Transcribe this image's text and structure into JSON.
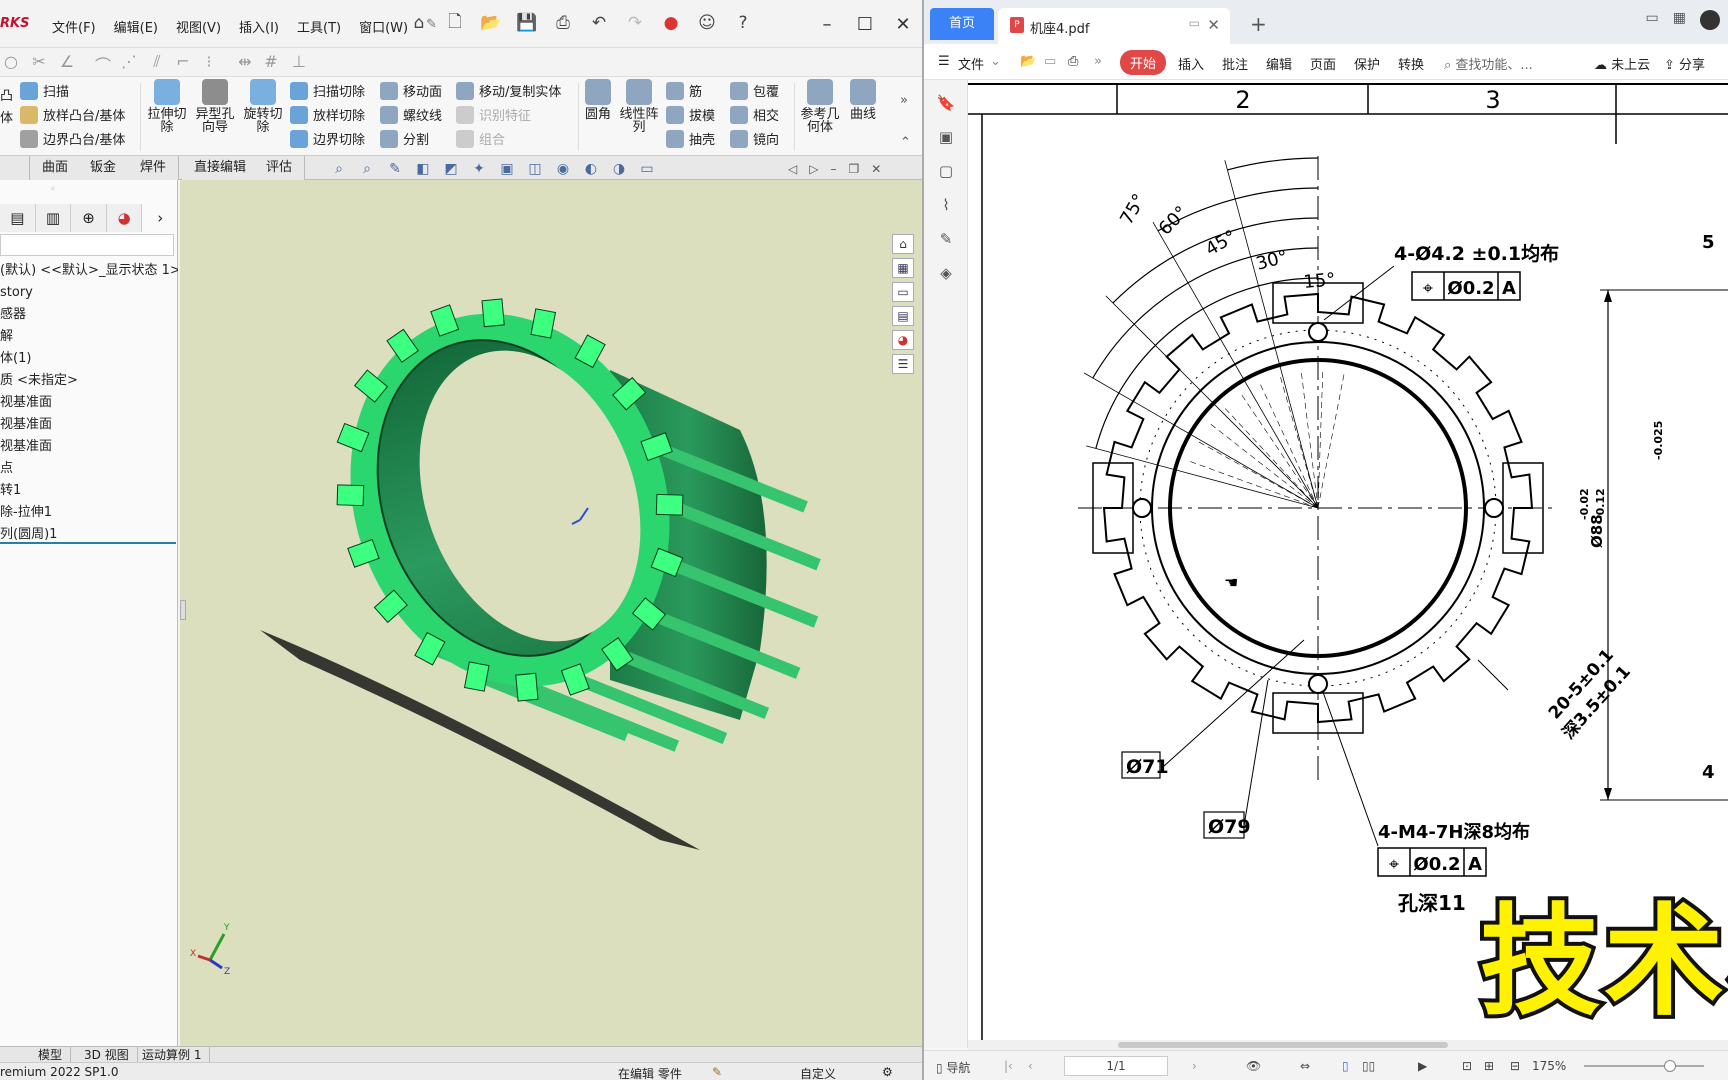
{
  "cad": {
    "brand": "RKS",
    "menu": [
      "文件(F)",
      "编辑(E)",
      "视图(V)",
      "插入(I)",
      "工具(T)",
      "窗口(W)"
    ],
    "ribbon": {
      "col1": [
        "扫描",
        "放样凸台/基体",
        "边界凸台/基体"
      ],
      "col1_partial": [
        "凸",
        "体"
      ],
      "big": [
        "拉伸切除",
        "异型孔向导",
        "旋转切除"
      ],
      "col2": [
        "扫描切除",
        "放样切除",
        "边界切除"
      ],
      "col3": [
        "移动面",
        "螺纹线",
        "分割"
      ],
      "col4": [
        "移动/复制实体",
        "识别特征",
        "组合"
      ],
      "big2": [
        "圆角",
        "线性阵列"
      ],
      "col5": [
        "筋",
        "拔模",
        "抽壳"
      ],
      "col6": [
        "包覆",
        "相交",
        "镜向"
      ],
      "big3": [
        "参考几何体",
        "曲线"
      ]
    },
    "tabs": [
      "曲面",
      "钣金",
      "焊件",
      "直接编辑",
      "评估"
    ],
    "tree": [
      "(默认) <<默认>_显示状态 1>",
      "story",
      "感器",
      "解",
      "体(1)",
      "质 <未指定>",
      "视基准面",
      "视基准面",
      "视基准面",
      "点",
      "转1",
      "除-拉伸1",
      "列(圆周)1"
    ],
    "bottom_tabs": [
      "模型",
      "3D 视图",
      "运动算例 1"
    ],
    "status": {
      "product": "remium 2022 SP1.0",
      "editing": "在编辑 零件",
      "custom": "自定义"
    },
    "part_color": "#1e8c4e",
    "tooth_color": "#3dff80",
    "viewport_bg": "#dcdfbe"
  },
  "pdf": {
    "home_tab": "首页",
    "doc_tab": "机座4.pdf",
    "menu": [
      "文件",
      "开始",
      "插入",
      "批注",
      "编辑",
      "页面",
      "保护",
      "转换"
    ],
    "search": "查找功能、...",
    "right_menu": [
      "未上云",
      "分享"
    ],
    "accent": "#e04848",
    "drawing": {
      "columns": [
        "2",
        "3"
      ],
      "angles": [
        "75°",
        "60°",
        "45°",
        "30°",
        "15°"
      ],
      "hole_callout_top": "4-Ø4.2 ±0.1均布",
      "fcf_top": [
        "⌖",
        "Ø0.2",
        "A"
      ],
      "d71": "Ø71",
      "d79": "Ø79",
      "slot": "20-5±0.1",
      "slot_depth": "深3.5±0.1",
      "thread_callout": "4-M4-7H深8均布",
      "fcf_bottom": [
        "⌖",
        "Ø0.2",
        "A"
      ],
      "hole_depth": "孔深11",
      "d88": "Ø88",
      "d88_tol_upper": "-0.02",
      "d88_tol_lower": "-0.12",
      "side_tol": "-0.025",
      "edge_labels": [
        "5",
        "4"
      ]
    },
    "status": {
      "nav": "导航",
      "page": "1/1",
      "zoom": "175%"
    }
  },
  "overlay": "技术栏"
}
